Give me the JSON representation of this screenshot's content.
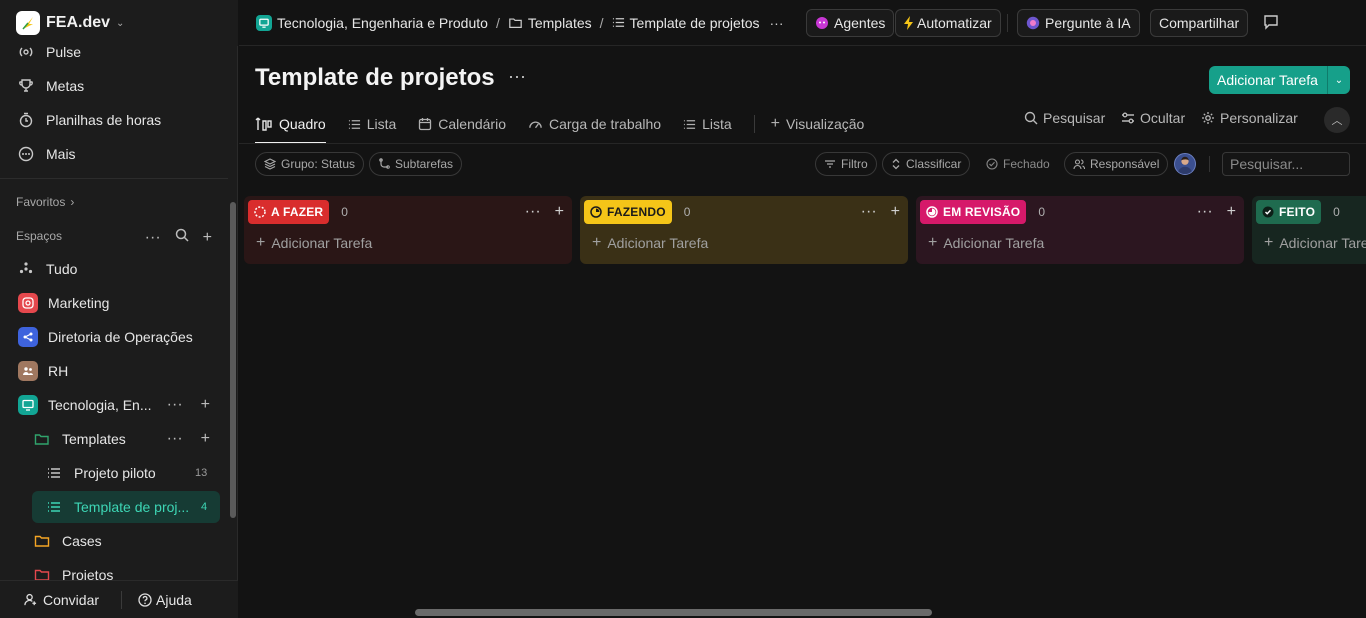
{
  "workspace": {
    "name": "FEA.dev"
  },
  "sidebar": {
    "nav": [
      {
        "label": "Pulse",
        "icon": "pulse-icon"
      },
      {
        "label": "Metas",
        "icon": "trophy-icon"
      },
      {
        "label": "Planilhas de horas",
        "icon": "timesheet-icon"
      },
      {
        "label": "Mais",
        "icon": "more-circle-icon"
      }
    ],
    "favorites_label": "Favoritos",
    "spaces_label": "Espaços",
    "spaces": [
      {
        "label": "Tudo",
        "icon": "all-icon"
      },
      {
        "label": "Marketing",
        "icon": "marketing-icon",
        "color": "#e5484d"
      },
      {
        "label": "Diretoria de Operações",
        "icon": "share-icon",
        "color": "#3e63dd"
      },
      {
        "label": "RH",
        "icon": "people-icon",
        "color": "#a07860"
      },
      {
        "label": "Tecnologia, En...",
        "icon": "monitor-icon",
        "color": "#12a594"
      }
    ],
    "folders": [
      {
        "label": "Templates",
        "color": "#30a46c"
      },
      {
        "label": "Cases",
        "color": "#f5a524"
      },
      {
        "label": "Projetos",
        "color": "#e5484d"
      }
    ],
    "lists": [
      {
        "label": "Projeto piloto",
        "count": "13"
      },
      {
        "label": "Template de proj...",
        "count": "4"
      }
    ],
    "footer": {
      "invite": "Convidar",
      "help": "Ajuda"
    }
  },
  "topbar": {
    "breadcrumb": [
      "Tecnologia, Engenharia e Produto",
      "Templates",
      "Template de projetos"
    ],
    "agents": "Agentes",
    "automate": "Automatizar",
    "ask_ai": "Pergunte à IA",
    "share": "Compartilhar"
  },
  "page": {
    "title": "Template de projetos",
    "add_task": "Adicionar Tarefa"
  },
  "tabs": [
    {
      "label": "Quadro",
      "active": true
    },
    {
      "label": "Lista"
    },
    {
      "label": "Calendário"
    },
    {
      "label": "Carga de trabalho"
    },
    {
      "label": "Lista"
    },
    {
      "label": "Visualização"
    }
  ],
  "tools": {
    "search": "Pesquisar",
    "hide": "Ocultar",
    "customize": "Personalizar"
  },
  "filters": {
    "group": "Grupo: Status",
    "subtasks": "Subtarefas",
    "filter": "Filtro",
    "sort": "Classificar",
    "closed": "Fechado",
    "assignee": "Responsável",
    "search_placeholder": "Pesquisar..."
  },
  "board": {
    "add_task_label": "Adicionar Tarefa",
    "columns": [
      {
        "status": "A FAZER",
        "count": "0",
        "badge_color": "#d92d2d",
        "bg": "#2a1616"
      },
      {
        "status": "FAZENDO",
        "count": "0",
        "badge_color": "#f5c518",
        "bg": "#3a3016"
      },
      {
        "status": "EM REVISÃO",
        "count": "0",
        "badge_color": "#d6196a",
        "bg": "#2c1620"
      },
      {
        "status": "FEITO",
        "count": "0",
        "badge_color": "#1f6b4f",
        "bg": "#172620"
      }
    ]
  }
}
